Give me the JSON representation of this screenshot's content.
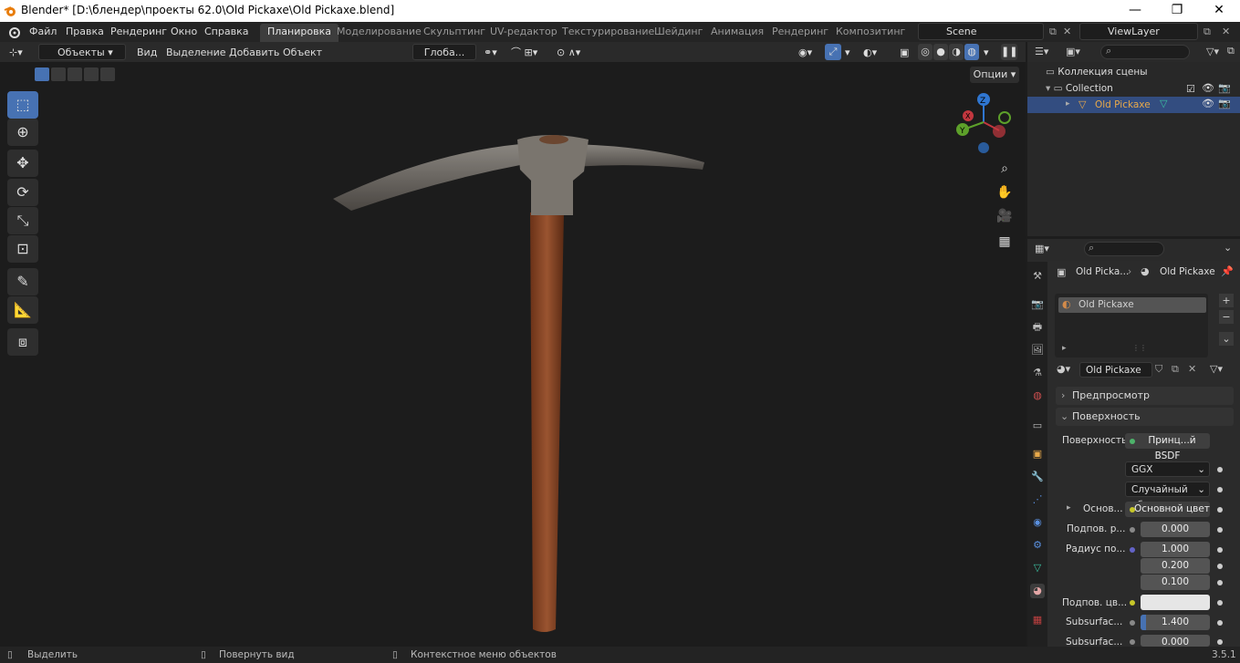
{
  "window": {
    "title": "Blender* [D:\\блендер\\проекты 62.0\\Old Pickaxe\\Old Pickaxe.blend]",
    "min": "—",
    "max": "❐",
    "close": "✕"
  },
  "menu": [
    "Файл",
    "Правка",
    "Рендеринг",
    "Окно",
    "Справка"
  ],
  "workspaces": [
    "Планировка",
    "Моделирование",
    "Скульптинг",
    "UV-редактор",
    "Текстурирование",
    "Шейдинг",
    "Анимация",
    "Рендеринг",
    "Композитинг"
  ],
  "scene": "Scene",
  "viewlayer": "ViewLayer",
  "header3d": {
    "mode": "Объекты",
    "view": "Вид",
    "select": "Выделение",
    "add": "Добавить",
    "object": "Объект",
    "orientation": "Глоба...",
    "options": "Опции"
  },
  "gizmo": {
    "x": "X",
    "y": "Y",
    "z": "Z"
  },
  "outliner": {
    "root": "Коллекция сцены",
    "collection": "Collection",
    "object": "Old Pickaxe"
  },
  "props": {
    "breadcrumb_obj": "Old Picka...",
    "breadcrumb_mat": "Old Pickaxe",
    "slot": "Old Pickaxe",
    "material_name": "Old Pickaxe",
    "preview": "Предпросмотр",
    "surface_header": "Поверхность",
    "surface_label": "Поверхность",
    "surface_value": "Принц...й BSDF",
    "distribution": "GGX",
    "subsurface_method": "Случайный об...",
    "base_label": "Основ...",
    "base_value": "Основной цвет",
    "sub_label": "Подпов. р...",
    "sub_value": "0.000",
    "radius_label": "Радиус по...",
    "radius_1": "1.000",
    "radius_2": "0.200",
    "radius_3": "0.100",
    "subcol_label": "Подпов. цв...",
    "ior_label": "Subsurfac...",
    "ior_value": "1.400",
    "aniso_label": "Subsurfac...",
    "aniso_value": "0.000"
  },
  "status": {
    "select": "Выделить",
    "rotate": "Повернуть вид",
    "context": "Контекстное меню объектов",
    "version": "3.5.1"
  },
  "colors": {
    "accent": "#4772b3",
    "selected_object": "#e8a94a"
  }
}
